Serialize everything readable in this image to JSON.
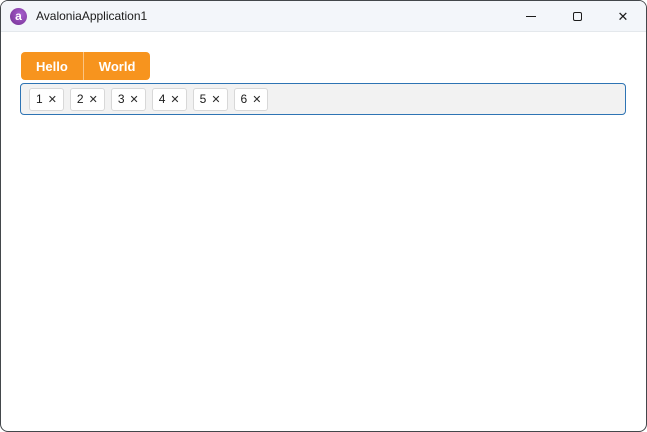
{
  "titlebar": {
    "title": "AvaloniaApplication1",
    "app_icon": "avalonia-logo",
    "logo_letter": "a",
    "close_glyph": "✕"
  },
  "tabstrip": {
    "items": [
      {
        "label": "Hello"
      },
      {
        "label": "World"
      }
    ]
  },
  "chip_input": {
    "chips": [
      {
        "value": "1"
      },
      {
        "value": "2"
      },
      {
        "value": "3"
      },
      {
        "value": "4"
      },
      {
        "value": "5"
      },
      {
        "value": "6"
      }
    ],
    "close_glyph": "✕"
  },
  "colors": {
    "tab_orange": "#f7941e",
    "focus_border_blue": "#2e74b4",
    "logo_purple": "#8b44ac",
    "titlebar_bg": "#f3f6fa",
    "chip_box_bg": "#f2f2f2"
  }
}
